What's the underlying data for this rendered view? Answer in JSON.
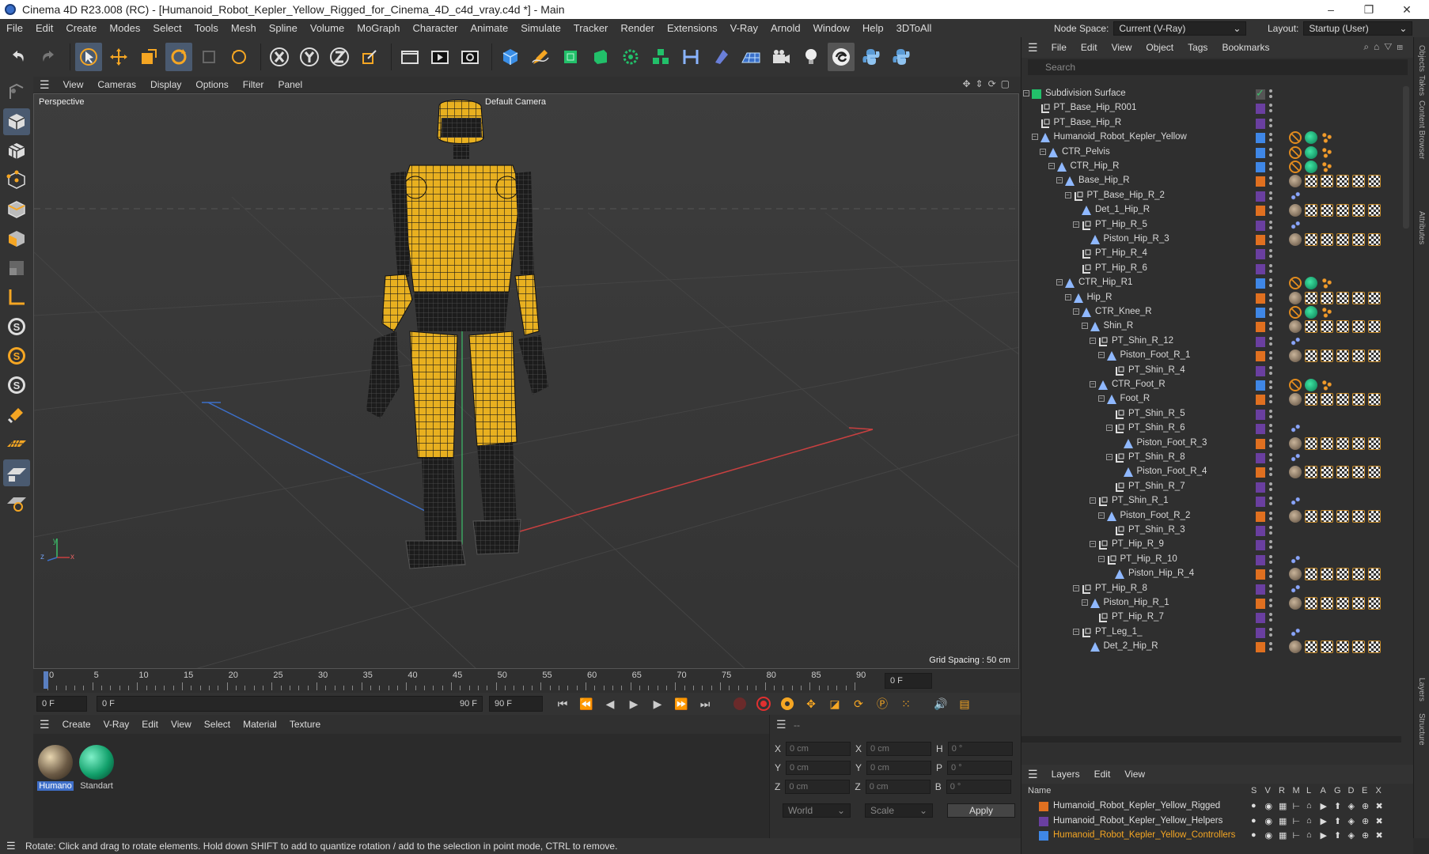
{
  "window": {
    "title": "Cinema 4D R23.008 (RC) - [Humanoid_Robot_Kepler_Yellow_Rigged_for_Cinema_4D_c4d_vray.c4d *] - Main",
    "minimize": "–",
    "maximize": "❐",
    "close": "✕"
  },
  "menubar": {
    "items": [
      "File",
      "Edit",
      "Create",
      "Modes",
      "Select",
      "Tools",
      "Mesh",
      "Spline",
      "Volume",
      "MoGraph",
      "Character",
      "Animate",
      "Simulate",
      "Tracker",
      "Render",
      "Extensions",
      "V-Ray",
      "Arnold",
      "Window",
      "Help",
      "3DToAll"
    ],
    "node_space_label": "Node Space:",
    "node_space_value": "Current (V-Ray)",
    "layout_label": "Layout:",
    "layout_value": "Startup (User)"
  },
  "viewport": {
    "menu": [
      "View",
      "Cameras",
      "Display",
      "Options",
      "Filter",
      "Panel"
    ],
    "projection": "Perspective",
    "camera": "Default Camera",
    "grid_spacing": "Grid Spacing : 50 cm",
    "axis_labels": {
      "y": "y",
      "z": "z",
      "x": "x"
    }
  },
  "timeline": {
    "ticks": [
      "0",
      "5",
      "10",
      "15",
      "20",
      "25",
      "30",
      "35",
      "40",
      "45",
      "50",
      "55",
      "60",
      "65",
      "70",
      "75",
      "80",
      "85",
      "90"
    ],
    "current_frame": "0 F",
    "start": "0 F",
    "range_start": "0 F",
    "range_end": "90 F",
    "end": "90 F"
  },
  "material_manager": {
    "menu": [
      "Create",
      "V-Ray",
      "Edit",
      "View",
      "Select",
      "Material",
      "Texture"
    ],
    "materials": [
      {
        "name": "Humano",
        "color": "#6b5a45"
      },
      {
        "name": "Standart",
        "color": "#12a06b"
      }
    ]
  },
  "coordinates": {
    "header": "--",
    "rows": [
      {
        "a": "X",
        "av": "0 cm",
        "b": "X",
        "bv": "0 cm",
        "c": "H",
        "cv": "0 °"
      },
      {
        "a": "Y",
        "av": "0 cm",
        "b": "Y",
        "bv": "0 cm",
        "c": "P",
        "cv": "0 °"
      },
      {
        "a": "Z",
        "av": "0 cm",
        "b": "Z",
        "bv": "0 cm",
        "c": "B",
        "cv": "0 °"
      }
    ],
    "mode": "World",
    "scale": "Scale",
    "apply": "Apply"
  },
  "status": "Rotate: Click and drag to rotate elements. Hold down SHIFT to add to quantize rotation / add to the selection in point mode, CTRL to remove.",
  "object_manager": {
    "menu": [
      "File",
      "Edit",
      "View",
      "Object",
      "Tags",
      "Bookmarks"
    ],
    "search_placeholder": "Search",
    "rows": [
      {
        "name": "Subdivision Surface",
        "depth": 0,
        "icon": "subd",
        "layer": "#555555",
        "tags": [
          "check"
        ],
        "conn": "minus"
      },
      {
        "name": "PT_Base_Hip_R001",
        "depth": 1,
        "icon": "null",
        "layer": "#6a3fa0",
        "tags": [],
        "conn": ""
      },
      {
        "name": "PT_Base_Hip_R",
        "depth": 1,
        "icon": "null",
        "layer": "#6a3fa0",
        "tags": [],
        "conn": ""
      },
      {
        "name": "Humanoid_Robot_Kepler_Yellow",
        "depth": 1,
        "icon": "joint",
        "layer": "#3f87e6",
        "tags": [
          "noe",
          "grn",
          "dots3"
        ],
        "conn": "minus"
      },
      {
        "name": "CTR_Pelvis",
        "depth": 2,
        "icon": "joint",
        "layer": "#3f87e6",
        "tags": [
          "noe",
          "grn",
          "dots3"
        ],
        "conn": "minus"
      },
      {
        "name": "CTR_Hip_R",
        "depth": 3,
        "icon": "joint",
        "layer": "#3f87e6",
        "tags": [
          "noe",
          "grn",
          "dots3"
        ],
        "conn": "minus"
      },
      {
        "name": "Base_Hip_R",
        "depth": 4,
        "icon": "joint",
        "layer": "#e07020",
        "tags": [
          "sub",
          "chk",
          "chk",
          "chk",
          "chk",
          "chk"
        ],
        "conn": "minus"
      },
      {
        "name": "PT_Base_Hip_R_2",
        "depth": 5,
        "icon": "null",
        "layer": "#6a3fa0",
        "tags": [
          "ik"
        ],
        "conn": "minus"
      },
      {
        "name": "Det_1_Hip_R",
        "depth": 6,
        "icon": "joint",
        "layer": "#e07020",
        "tags": [
          "sub",
          "chk",
          "chk",
          "chk",
          "chk",
          "chk"
        ],
        "conn": ""
      },
      {
        "name": "PT_Hip_R_5",
        "depth": 6,
        "icon": "null",
        "layer": "#6a3fa0",
        "tags": [
          "ik"
        ],
        "conn": "minus"
      },
      {
        "name": "Piston_Hip_R_3",
        "depth": 7,
        "icon": "joint",
        "layer": "#e07020",
        "tags": [
          "sub",
          "chk",
          "chk",
          "chk",
          "chk",
          "chk"
        ],
        "conn": ""
      },
      {
        "name": "PT_Hip_R_4",
        "depth": 6,
        "icon": "null",
        "layer": "#6a3fa0",
        "tags": [],
        "conn": ""
      },
      {
        "name": "PT_Hip_R_6",
        "depth": 6,
        "icon": "null",
        "layer": "#6a3fa0",
        "tags": [],
        "conn": ""
      },
      {
        "name": "CTR_Hip_R1",
        "depth": 4,
        "icon": "joint",
        "layer": "#3f87e6",
        "tags": [
          "noe",
          "grn",
          "dots3"
        ],
        "conn": "minus"
      },
      {
        "name": "Hip_R",
        "depth": 5,
        "icon": "joint",
        "layer": "#e07020",
        "tags": [
          "sub",
          "chk",
          "chk",
          "chk",
          "chk",
          "chk"
        ],
        "conn": "minus"
      },
      {
        "name": "CTR_Knee_R",
        "depth": 6,
        "icon": "joint",
        "layer": "#3f87e6",
        "tags": [
          "noe",
          "grn",
          "dots3"
        ],
        "conn": "minus"
      },
      {
        "name": "Shin_R",
        "depth": 7,
        "icon": "joint",
        "layer": "#e07020",
        "tags": [
          "sub",
          "chk",
          "chk",
          "chk",
          "chk",
          "chk"
        ],
        "conn": "minus"
      },
      {
        "name": "PT_Shin_R_12",
        "depth": 8,
        "icon": "null",
        "layer": "#6a3fa0",
        "tags": [
          "ik"
        ],
        "conn": "minus"
      },
      {
        "name": "Piston_Foot_R_1",
        "depth": 9,
        "icon": "joint",
        "layer": "#e07020",
        "tags": [
          "sub",
          "chk",
          "chk",
          "chk",
          "chk",
          "chk"
        ],
        "conn": "minus"
      },
      {
        "name": "PT_Shin_R_4",
        "depth": 10,
        "icon": "null",
        "layer": "#6a3fa0",
        "tags": [],
        "conn": ""
      },
      {
        "name": "CTR_Foot_R",
        "depth": 8,
        "icon": "joint",
        "layer": "#3f87e6",
        "tags": [
          "noe",
          "grn",
          "dots3"
        ],
        "conn": "minus"
      },
      {
        "name": "Foot_R",
        "depth": 9,
        "icon": "joint",
        "layer": "#e07020",
        "tags": [
          "sub",
          "chk",
          "chk",
          "chk",
          "chk",
          "chk"
        ],
        "conn": "minus"
      },
      {
        "name": "PT_Shin_R_5",
        "depth": 10,
        "icon": "null",
        "layer": "#6a3fa0",
        "tags": [],
        "conn": ""
      },
      {
        "name": "PT_Shin_R_6",
        "depth": 10,
        "icon": "null",
        "layer": "#6a3fa0",
        "tags": [
          "ik"
        ],
        "conn": "minus"
      },
      {
        "name": "Piston_Foot_R_3",
        "depth": 11,
        "icon": "joint",
        "layer": "#e07020",
        "tags": [
          "sub",
          "chk",
          "chk",
          "chk",
          "chk",
          "chk"
        ],
        "conn": ""
      },
      {
        "name": "PT_Shin_R_8",
        "depth": 10,
        "icon": "null",
        "layer": "#6a3fa0",
        "tags": [
          "ik"
        ],
        "conn": "minus"
      },
      {
        "name": "Piston_Foot_R_4",
        "depth": 11,
        "icon": "joint",
        "layer": "#e07020",
        "tags": [
          "sub",
          "chk",
          "chk",
          "chk",
          "chk",
          "chk"
        ],
        "conn": ""
      },
      {
        "name": "PT_Shin_R_7",
        "depth": 10,
        "icon": "null",
        "layer": "#6a3fa0",
        "tags": [],
        "conn": ""
      },
      {
        "name": "PT_Shin_R_1",
        "depth": 8,
        "icon": "null",
        "layer": "#6a3fa0",
        "tags": [
          "ik"
        ],
        "conn": "minus"
      },
      {
        "name": "Piston_Foot_R_2",
        "depth": 9,
        "icon": "joint",
        "layer": "#e07020",
        "tags": [
          "sub",
          "chk",
          "chk",
          "chk",
          "chk",
          "chk"
        ],
        "conn": "minus"
      },
      {
        "name": "PT_Shin_R_3",
        "depth": 10,
        "icon": "null",
        "layer": "#6a3fa0",
        "tags": [],
        "conn": ""
      },
      {
        "name": "PT_Hip_R_9",
        "depth": 8,
        "icon": "null",
        "layer": "#6a3fa0",
        "tags": [],
        "conn": "minus"
      },
      {
        "name": "PT_Hip_R_10",
        "depth": 9,
        "icon": "null",
        "layer": "#6a3fa0",
        "tags": [
          "ik"
        ],
        "conn": "minus"
      },
      {
        "name": "Piston_Hip_R_4",
        "depth": 10,
        "icon": "joint",
        "layer": "#e07020",
        "tags": [
          "sub",
          "chk",
          "chk",
          "chk",
          "chk",
          "chk"
        ],
        "conn": ""
      },
      {
        "name": "PT_Hip_R_8",
        "depth": 6,
        "icon": "null",
        "layer": "#6a3fa0",
        "tags": [
          "ik"
        ],
        "conn": "minus"
      },
      {
        "name": "Piston_Hip_R_1",
        "depth": 7,
        "icon": "joint",
        "layer": "#e07020",
        "tags": [
          "sub",
          "chk",
          "chk",
          "chk",
          "chk",
          "chk"
        ],
        "conn": "minus"
      },
      {
        "name": "PT_Hip_R_7",
        "depth": 8,
        "icon": "null",
        "layer": "#6a3fa0",
        "tags": [],
        "conn": ""
      },
      {
        "name": "PT_Leg_1_",
        "depth": 6,
        "icon": "null",
        "layer": "#6a3fa0",
        "tags": [
          "ik"
        ],
        "conn": "minus"
      },
      {
        "name": "Det_2_Hip_R",
        "depth": 7,
        "icon": "joint",
        "layer": "#e07020",
        "tags": [
          "sub",
          "chk",
          "chk",
          "chk",
          "chk",
          "chk"
        ],
        "conn": ""
      }
    ]
  },
  "right_tabs": [
    "Objects",
    "Takes",
    "Content Browser",
    "Attributes",
    "Layers",
    "Structure"
  ],
  "layer_manager": {
    "menu": [
      "Layers",
      "Edit",
      "View"
    ],
    "col_name": "Name",
    "cols": [
      "S",
      "V",
      "R",
      "M",
      "L",
      "A",
      "G",
      "D",
      "E",
      "X"
    ],
    "layers": [
      {
        "name": "Humanoid_Robot_Kepler_Yellow_Rigged",
        "color": "#e07020",
        "highlight": false
      },
      {
        "name": "Humanoid_Robot_Kepler_Yellow_Helpers",
        "color": "#6a3fa0",
        "highlight": false
      },
      {
        "name": "Humanoid_Robot_Kepler_Yellow_Controllers",
        "color": "#3f87e6",
        "highlight": true
      }
    ]
  }
}
